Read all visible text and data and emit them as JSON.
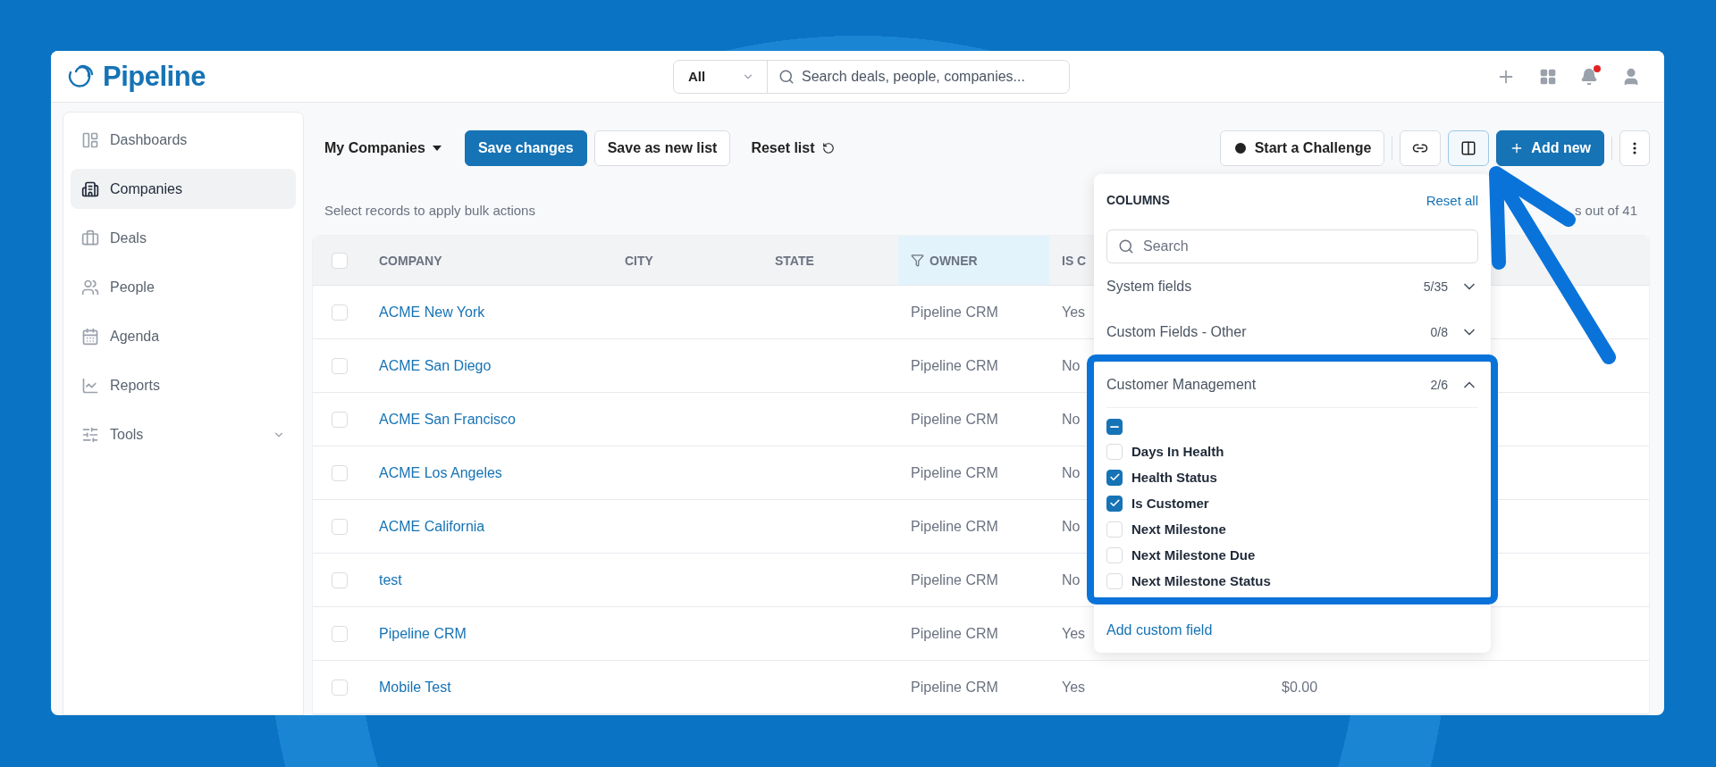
{
  "app": {
    "name": "Pipeline"
  },
  "search": {
    "scope": "All",
    "placeholder": "Search deals, people, companies..."
  },
  "sidebar": {
    "items": [
      {
        "label": "Dashboards",
        "selected": false,
        "kind": "link"
      },
      {
        "label": "Companies",
        "selected": true,
        "kind": "link"
      },
      {
        "label": "Deals",
        "selected": false,
        "kind": "link"
      },
      {
        "label": "People",
        "selected": false,
        "kind": "link"
      },
      {
        "label": "Agenda",
        "selected": false,
        "kind": "link"
      },
      {
        "label": "Reports",
        "selected": false,
        "kind": "link"
      },
      {
        "label": "Tools",
        "selected": false,
        "kind": "group"
      }
    ]
  },
  "toolbar": {
    "list_name": "My Companies",
    "buttons": [
      {
        "label": "Save changes",
        "kind": "primary"
      },
      {
        "label": "Save as new list",
        "kind": "outline"
      },
      {
        "label": "Reset list",
        "kind": "plain"
      }
    ],
    "challenge": "Start a Challenge",
    "add_new": "Add new"
  },
  "bulk_hint": "Select records to apply bulk actions",
  "record_count": "s out of 41",
  "table": {
    "all_selected": false,
    "columns": [
      {
        "label": "COMPANY",
        "filtered": false
      },
      {
        "label": "CITY",
        "filtered": false
      },
      {
        "label": "STATE",
        "filtered": false
      },
      {
        "label": "OWNER",
        "filtered": true
      },
      {
        "label": "IS C",
        "filtered": false
      }
    ],
    "rows": [
      {
        "company": "ACME New York",
        "owner": "Pipeline CRM",
        "column_5": "Yes",
        "selected": false
      },
      {
        "company": "ACME San Diego",
        "owner": "Pipeline CRM",
        "column_5": "No",
        "selected": false
      },
      {
        "company": "ACME San Francisco",
        "owner": "Pipeline CRM",
        "column_5": "No",
        "selected": false
      },
      {
        "company": "ACME Los Angeles",
        "owner": "Pipeline CRM",
        "column_5": "No",
        "selected": false
      },
      {
        "company": "ACME California",
        "owner": "Pipeline CRM",
        "column_5": "No",
        "selected": false
      },
      {
        "company": "test",
        "owner": "Pipeline CRM",
        "column_5": "No",
        "selected": false
      },
      {
        "company": "Pipeline CRM",
        "owner": "Pipeline CRM",
        "column_5": "Yes",
        "selected": false
      },
      {
        "company": "Mobile Test",
        "owner": "Pipeline CRM",
        "column_5": "Yes",
        "column_6": "$0.00",
        "selected": false
      }
    ]
  },
  "columns_panel": {
    "title": "COLUMNS",
    "reset": "Reset all",
    "search_placeholder": "Search",
    "groups": [
      {
        "label": "System fields",
        "count": "5/35",
        "expanded": false
      },
      {
        "label": "Custom Fields - Other",
        "count": "0/8",
        "expanded": false
      },
      {
        "label": "Customer Management",
        "count": "2/6",
        "expanded": true,
        "highlighted": true,
        "select_all_indeterminate": true,
        "fields": [
          {
            "label": "Days In Health",
            "checked": false
          },
          {
            "label": "Health Status",
            "checked": true
          },
          {
            "label": "Is Customer",
            "checked": true
          },
          {
            "label": "Next Milestone",
            "checked": false
          },
          {
            "label": "Next Milestone Due",
            "checked": false
          },
          {
            "label": "Next Milestone Status",
            "checked": false
          }
        ]
      }
    ],
    "add_link": "Add custom field"
  }
}
